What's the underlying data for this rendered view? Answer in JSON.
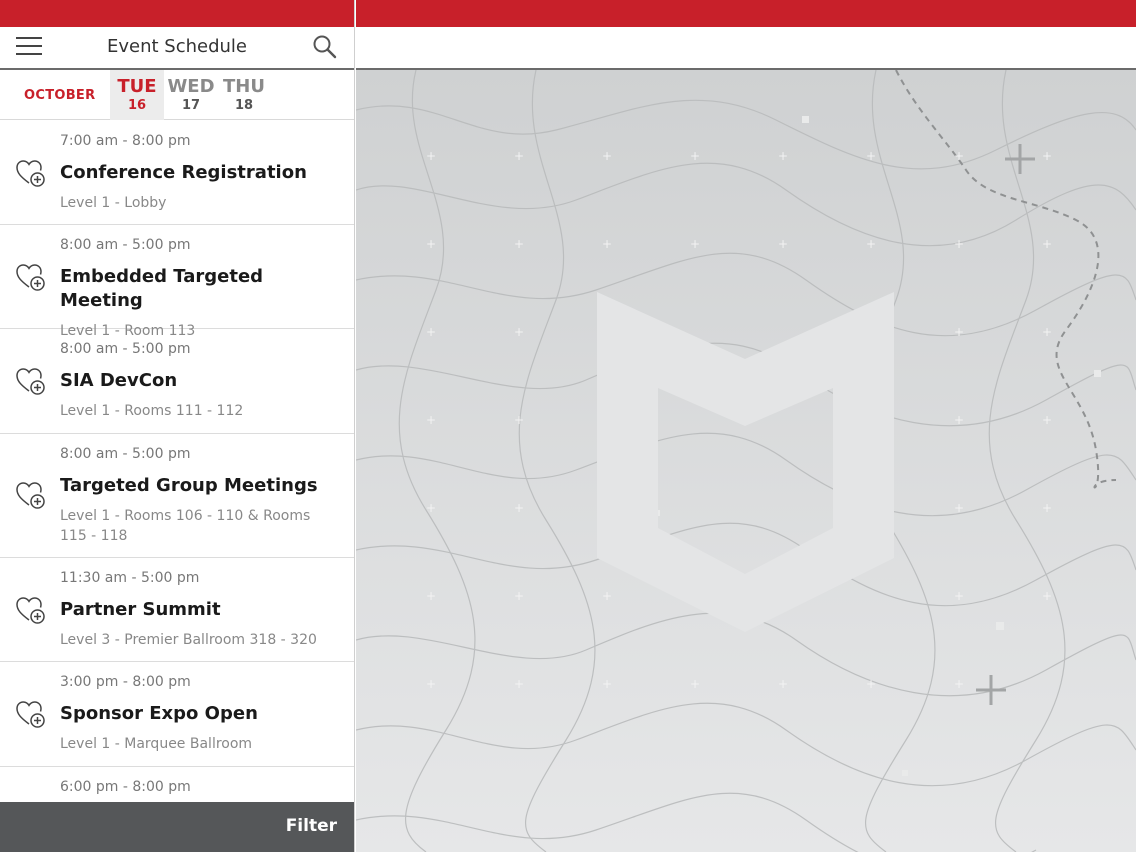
{
  "header": {
    "title": "Event Schedule",
    "menu_icon": "hamburger-menu-icon",
    "search_icon": "search-icon"
  },
  "datebar": {
    "month": "OCTOBER",
    "days": [
      {
        "name": "TUE",
        "num": "16",
        "active": true
      },
      {
        "name": "WED",
        "num": "17",
        "active": false
      },
      {
        "name": "THU",
        "num": "18",
        "active": false
      }
    ]
  },
  "events": [
    {
      "time": "7:00 am - 8:00 pm",
      "title": "Conference Registration",
      "location": "Level 1 - Lobby"
    },
    {
      "time": "8:00 am - 5:00 pm",
      "title": "Embedded Targeted Meeting",
      "location": "Level 1 - Room 113"
    },
    {
      "time": "8:00 am - 5:00 pm",
      "title": "SIA DevCon",
      "location": "Level 1 - Rooms 111 - 112"
    },
    {
      "time": "8:00 am - 5:00 pm",
      "title": "Targeted Group Meetings",
      "location": "Level 1 - Rooms 106 - 110 & Rooms 115 - 118"
    },
    {
      "time": "11:30 am - 5:00 pm",
      "title": "Partner Summit",
      "location": "Level 3 - Premier Ballroom 318 - 320"
    },
    {
      "time": "3:00 pm - 8:00 pm",
      "title": "Sponsor Expo Open",
      "location": "Level 1 - Marquee Ballroom"
    },
    {
      "time": "6:00 pm - 8:00 pm",
      "title": "",
      "location": ""
    }
  ],
  "filter": {
    "label": "Filter"
  },
  "colors": {
    "brand": "#c8202a",
    "filterbar": "#555759",
    "map_bg": "#d8dadb"
  }
}
